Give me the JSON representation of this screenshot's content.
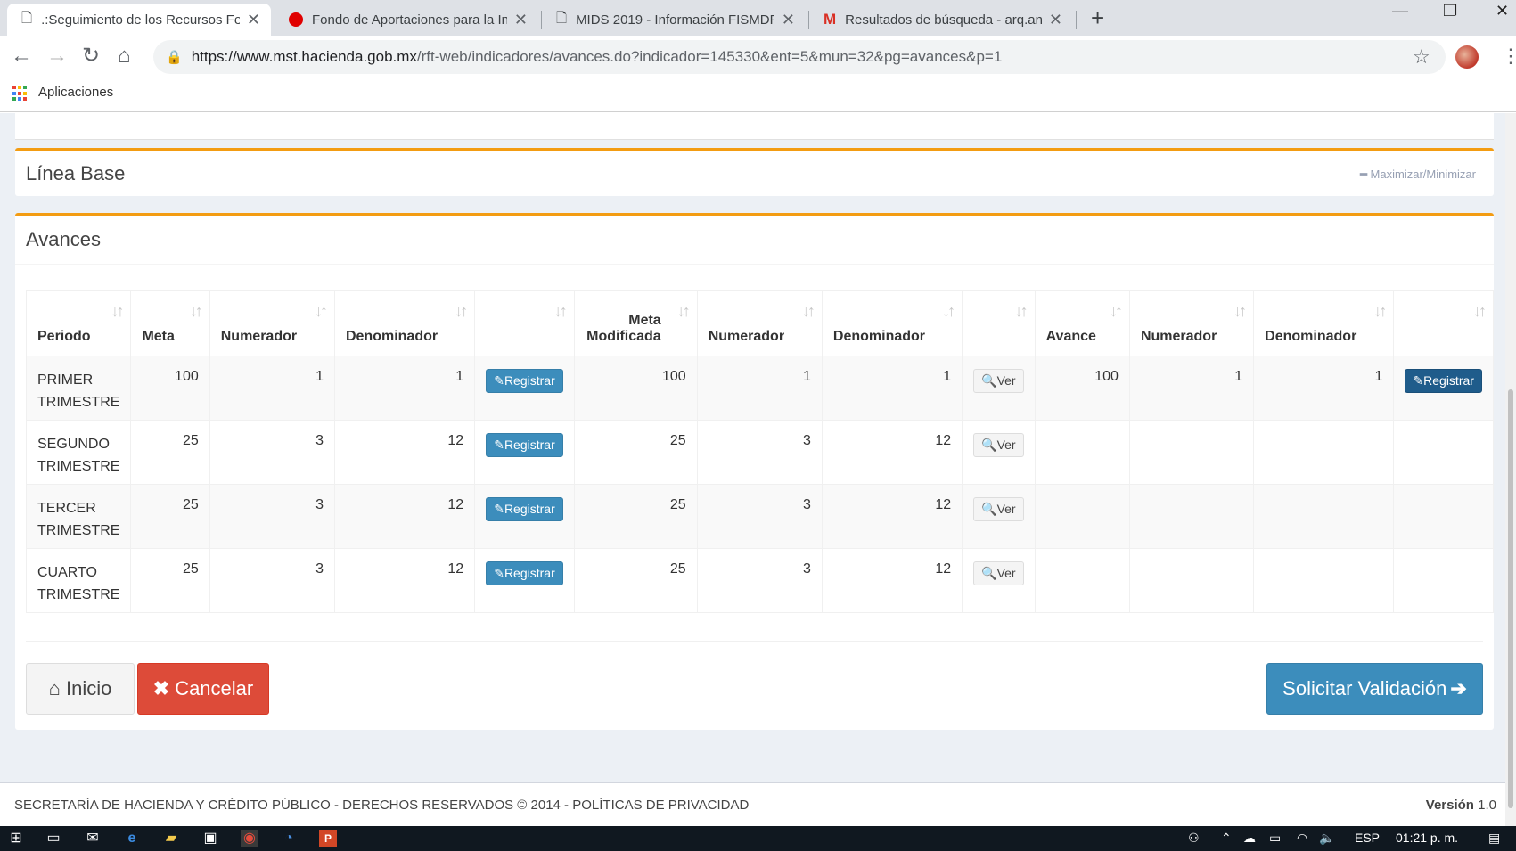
{
  "browser": {
    "tabs": [
      {
        "title": ".:Seguimiento de los Recursos Fe",
        "icon": "page-icon"
      },
      {
        "title": "Fondo de Aportaciones para la In",
        "icon": "red-circle-icon"
      },
      {
        "title": "MIDS 2019 - Información FISMDF",
        "icon": "page-icon"
      },
      {
        "title": "Resultados de búsqueda - arq.an",
        "icon": "gmail-icon"
      }
    ],
    "url_host": "https://www.mst.hacienda.gob.mx",
    "url_path": "/rft-web/indicadores/avances.do?indicador=145330&ent=5&mun=32&pg=avances&p=1",
    "bookmark_label": "Aplicaciones"
  },
  "linea_base": {
    "title": "Línea Base",
    "toggle_label": "Maximizar/Minimizar"
  },
  "avances": {
    "title": "Avances",
    "columns": [
      "Periodo",
      "Meta",
      "Numerador",
      "Denominador",
      "",
      "Meta Modificada",
      "Numerador",
      "Denominador",
      "",
      "Avance",
      "Numerador",
      "Denominador",
      ""
    ],
    "register_label": "Registrar",
    "view_label": "Ver",
    "rows": [
      {
        "periodo_1": "PRIMER",
        "periodo_2": "TRIMESTRE",
        "meta": "100",
        "num": "1",
        "den": "1",
        "meta_mod": "100",
        "num_mod": "1",
        "den_mod": "1",
        "avance": "100",
        "num_av": "1",
        "den_av": "1"
      },
      {
        "periodo_1": "SEGUNDO",
        "periodo_2": "TRIMESTRE",
        "meta": "25",
        "num": "3",
        "den": "12",
        "meta_mod": "25",
        "num_mod": "3",
        "den_mod": "12",
        "avance": "",
        "num_av": "",
        "den_av": ""
      },
      {
        "periodo_1": "TERCER",
        "periodo_2": "TRIMESTRE",
        "meta": "25",
        "num": "3",
        "den": "12",
        "meta_mod": "25",
        "num_mod": "3",
        "den_mod": "12",
        "avance": "",
        "num_av": "",
        "den_av": ""
      },
      {
        "periodo_1": "CUARTO",
        "periodo_2": "TRIMESTRE",
        "meta": "25",
        "num": "3",
        "den": "12",
        "meta_mod": "25",
        "num_mod": "3",
        "den_mod": "12",
        "avance": "",
        "num_av": "",
        "den_av": ""
      }
    ]
  },
  "actions": {
    "inicio": "Inicio",
    "cancelar": "Cancelar",
    "validar": "Solicitar Validación"
  },
  "footer": {
    "left": "SECRETARÍA DE HACIENDA Y CRÉDITO PÚBLICO - DERECHOS RESERVADOS © 2014 - POLÍTICAS DE PRIVACIDAD",
    "version_label": "Versión",
    "version_value": "1.0"
  },
  "taskbar": {
    "lang": "ESP",
    "time": "01:21 p. m."
  },
  "colors": {
    "accent": "#f39c12",
    "primary": "#3c8dbc",
    "danger": "#dd4b39"
  }
}
